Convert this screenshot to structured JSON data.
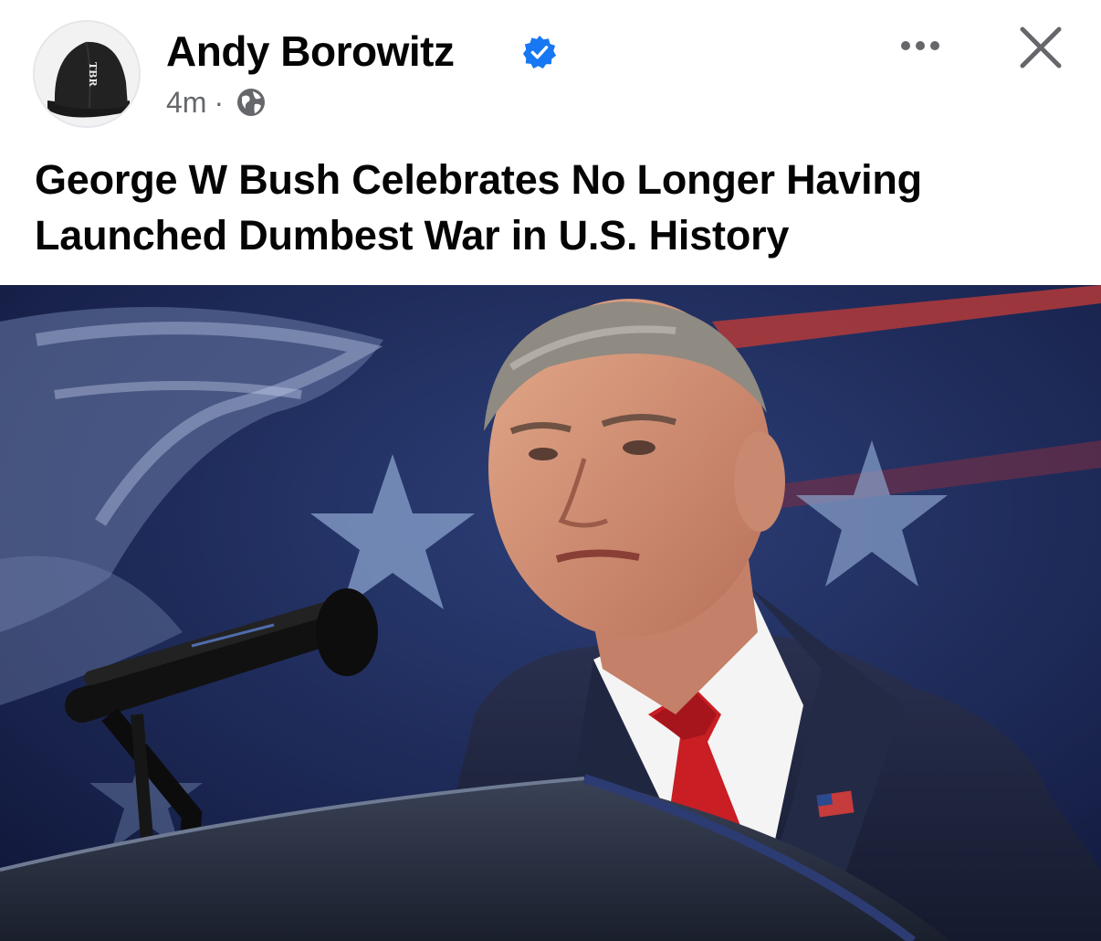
{
  "post": {
    "author_name": "Andy Borowitz",
    "verified": true,
    "time": "4m",
    "separator": "·",
    "audience_icon": "globe-icon",
    "avatar_cap_text": "TBR",
    "headline": "George W Bush Celebrates No Longer Having Launched Dumbest War in U.S. History",
    "actions": {
      "more_icon": "more-dots-icon",
      "close_icon": "close-icon"
    }
  },
  "colors": {
    "verified_badge": "#1877f2",
    "secondary_text": "#65676b",
    "primary_text": "#050505"
  }
}
